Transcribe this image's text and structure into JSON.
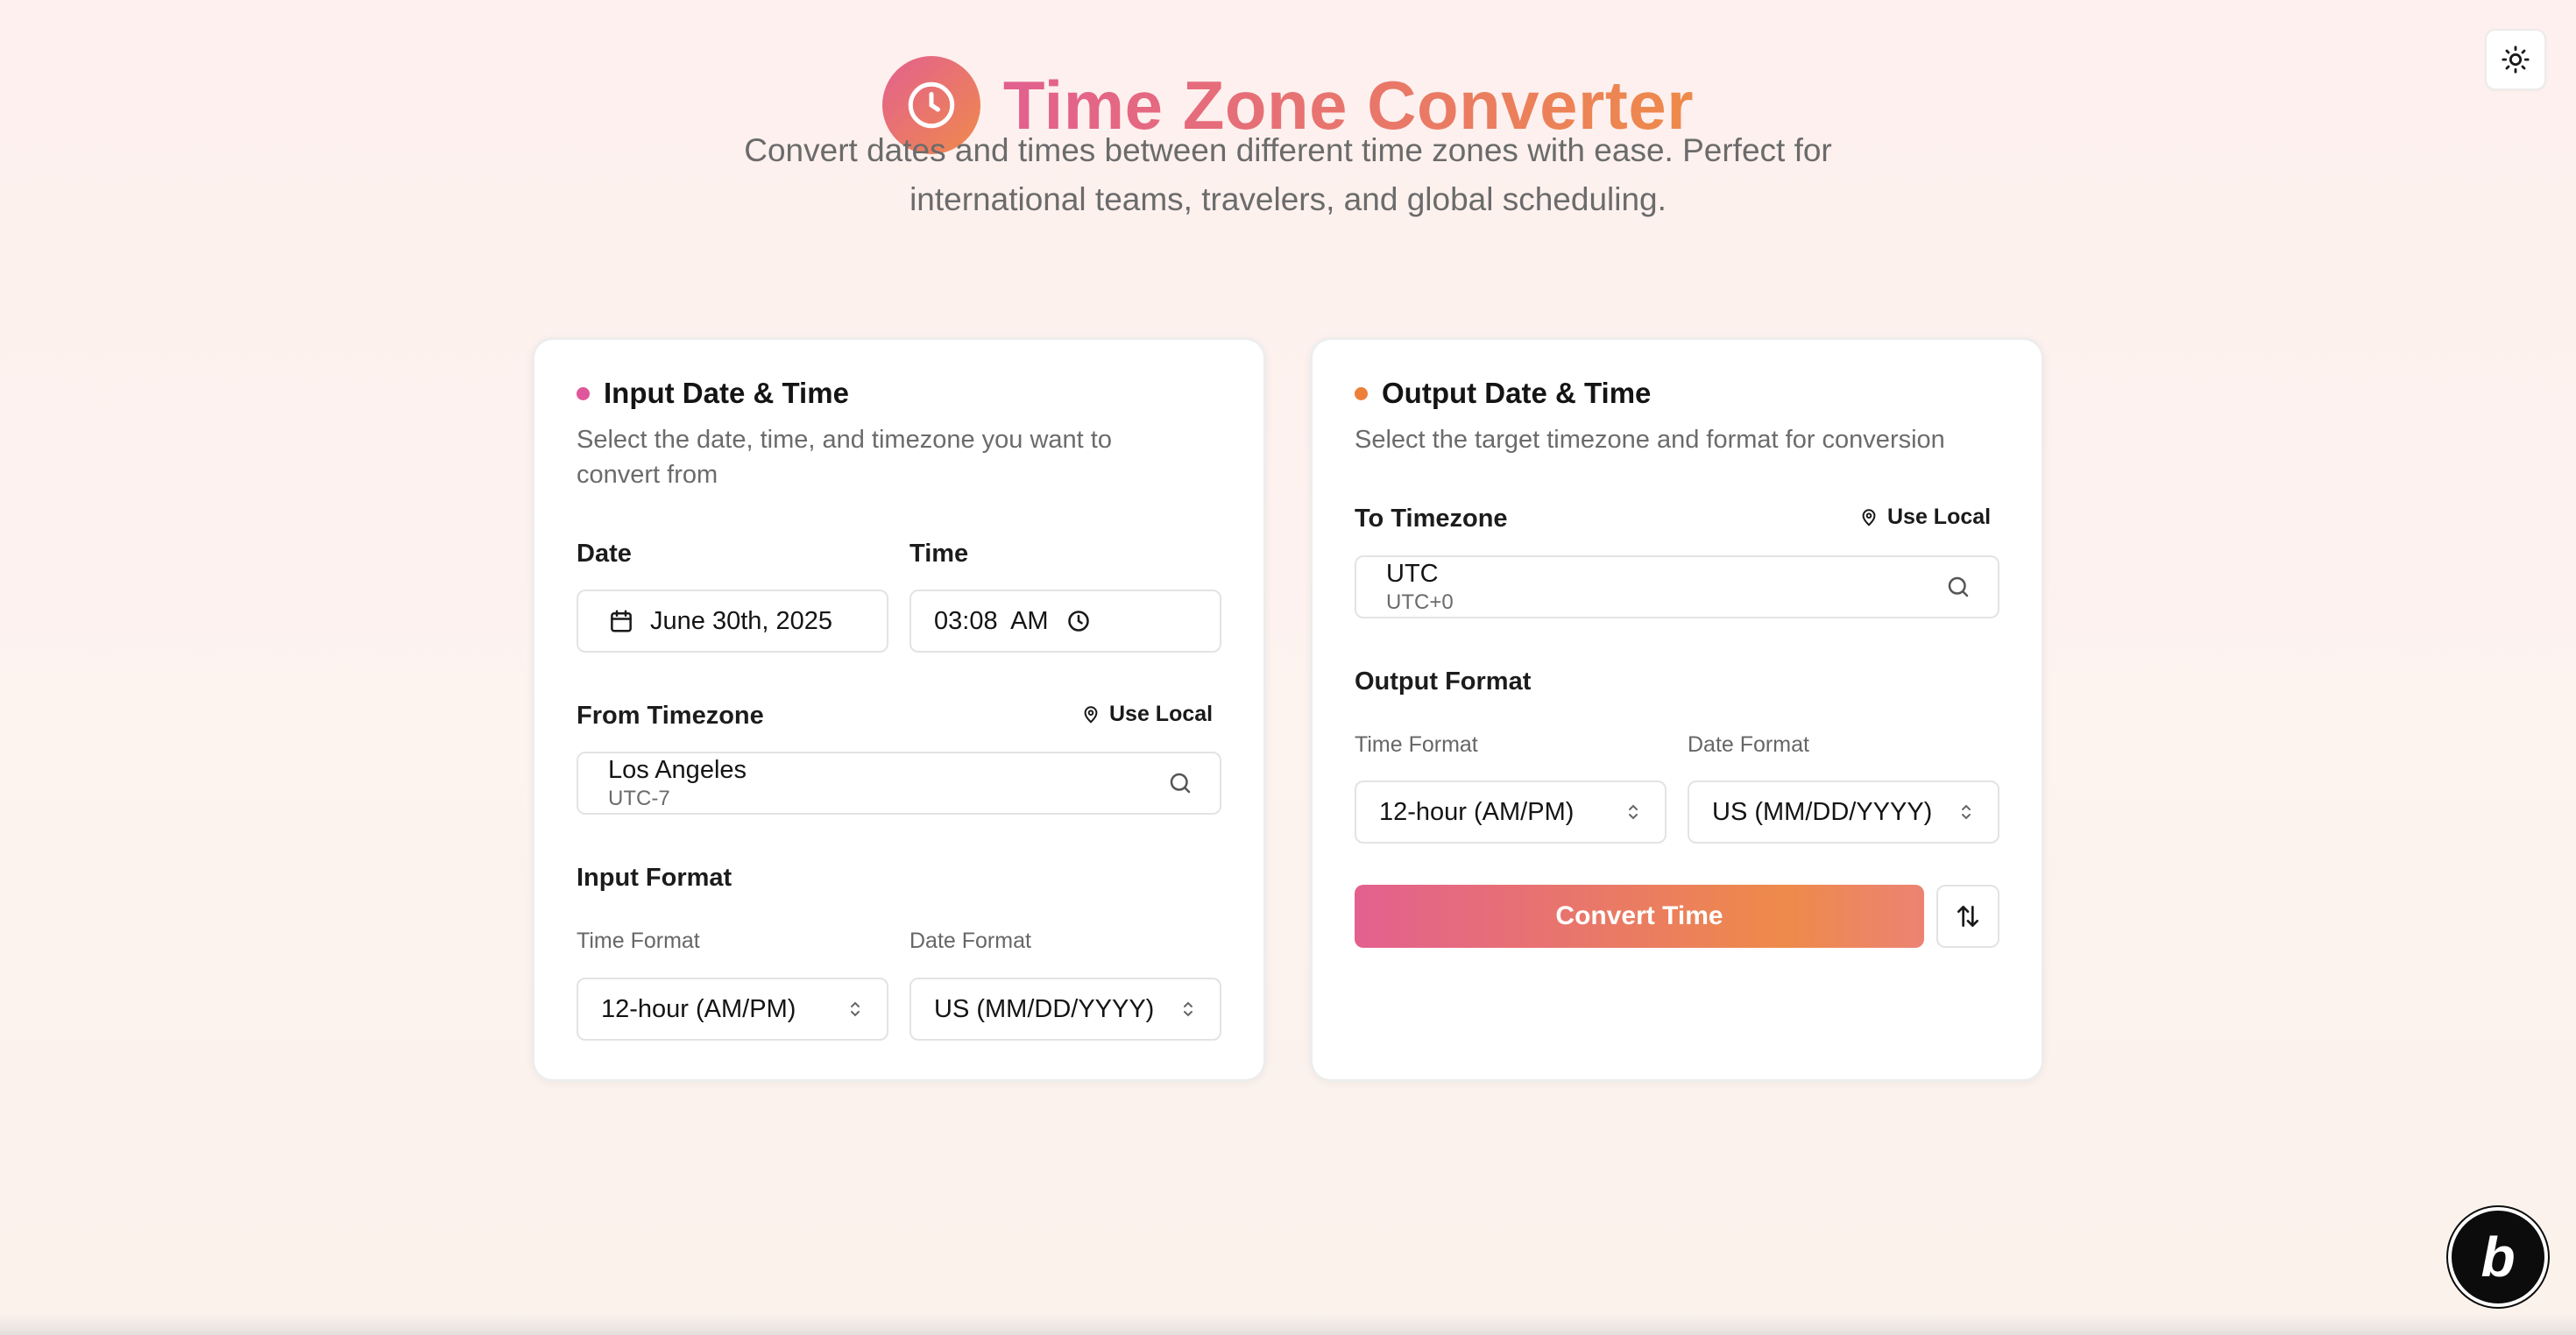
{
  "app": {
    "title": "Time Zone Converter",
    "subtitle": "Convert dates and times between different time zones with ease. Perfect for international teams, travelers, and global scheduling."
  },
  "colors": {
    "gradient_start": "#e3608f",
    "gradient_end": "#ee8a4a",
    "input_dot": "#e0569a",
    "output_dot": "#ee7f3a"
  },
  "input_card": {
    "title": "Input Date & Time",
    "description": "Select the date, time, and timezone you want to convert from",
    "date_label": "Date",
    "date_value": "June 30th, 2025",
    "time_label": "Time",
    "time_value": "03:08  AM",
    "timezone_label": "From Timezone",
    "use_local": "Use Local",
    "timezone_name": "Los Angeles",
    "timezone_offset": "UTC-7",
    "format_heading": "Input Format",
    "time_format_label": "Time Format",
    "time_format_value": "12-hour (AM/PM)",
    "date_format_label": "Date Format",
    "date_format_value": "US (MM/DD/YYYY)"
  },
  "output_card": {
    "title": "Output Date & Time",
    "description": "Select the target timezone and format for conversion",
    "timezone_label": "To Timezone",
    "use_local": "Use Local",
    "timezone_name": "UTC",
    "timezone_offset": "UTC+0",
    "format_heading": "Output Format",
    "time_format_label": "Time Format",
    "time_format_value": "12-hour (AM/PM)",
    "date_format_label": "Date Format",
    "date_format_value": "US (MM/DD/YYYY)",
    "convert_button": "Convert Time"
  },
  "icons": {
    "theme_toggle": "sun-icon",
    "logo": "clock-icon",
    "date": "calendar-icon",
    "time": "clock-icon",
    "use_local": "map-pin-icon",
    "search": "search-icon",
    "select": "chevron-up-down-icon",
    "swap": "swap-vertical-icon"
  },
  "badge": {
    "letter": "b"
  }
}
